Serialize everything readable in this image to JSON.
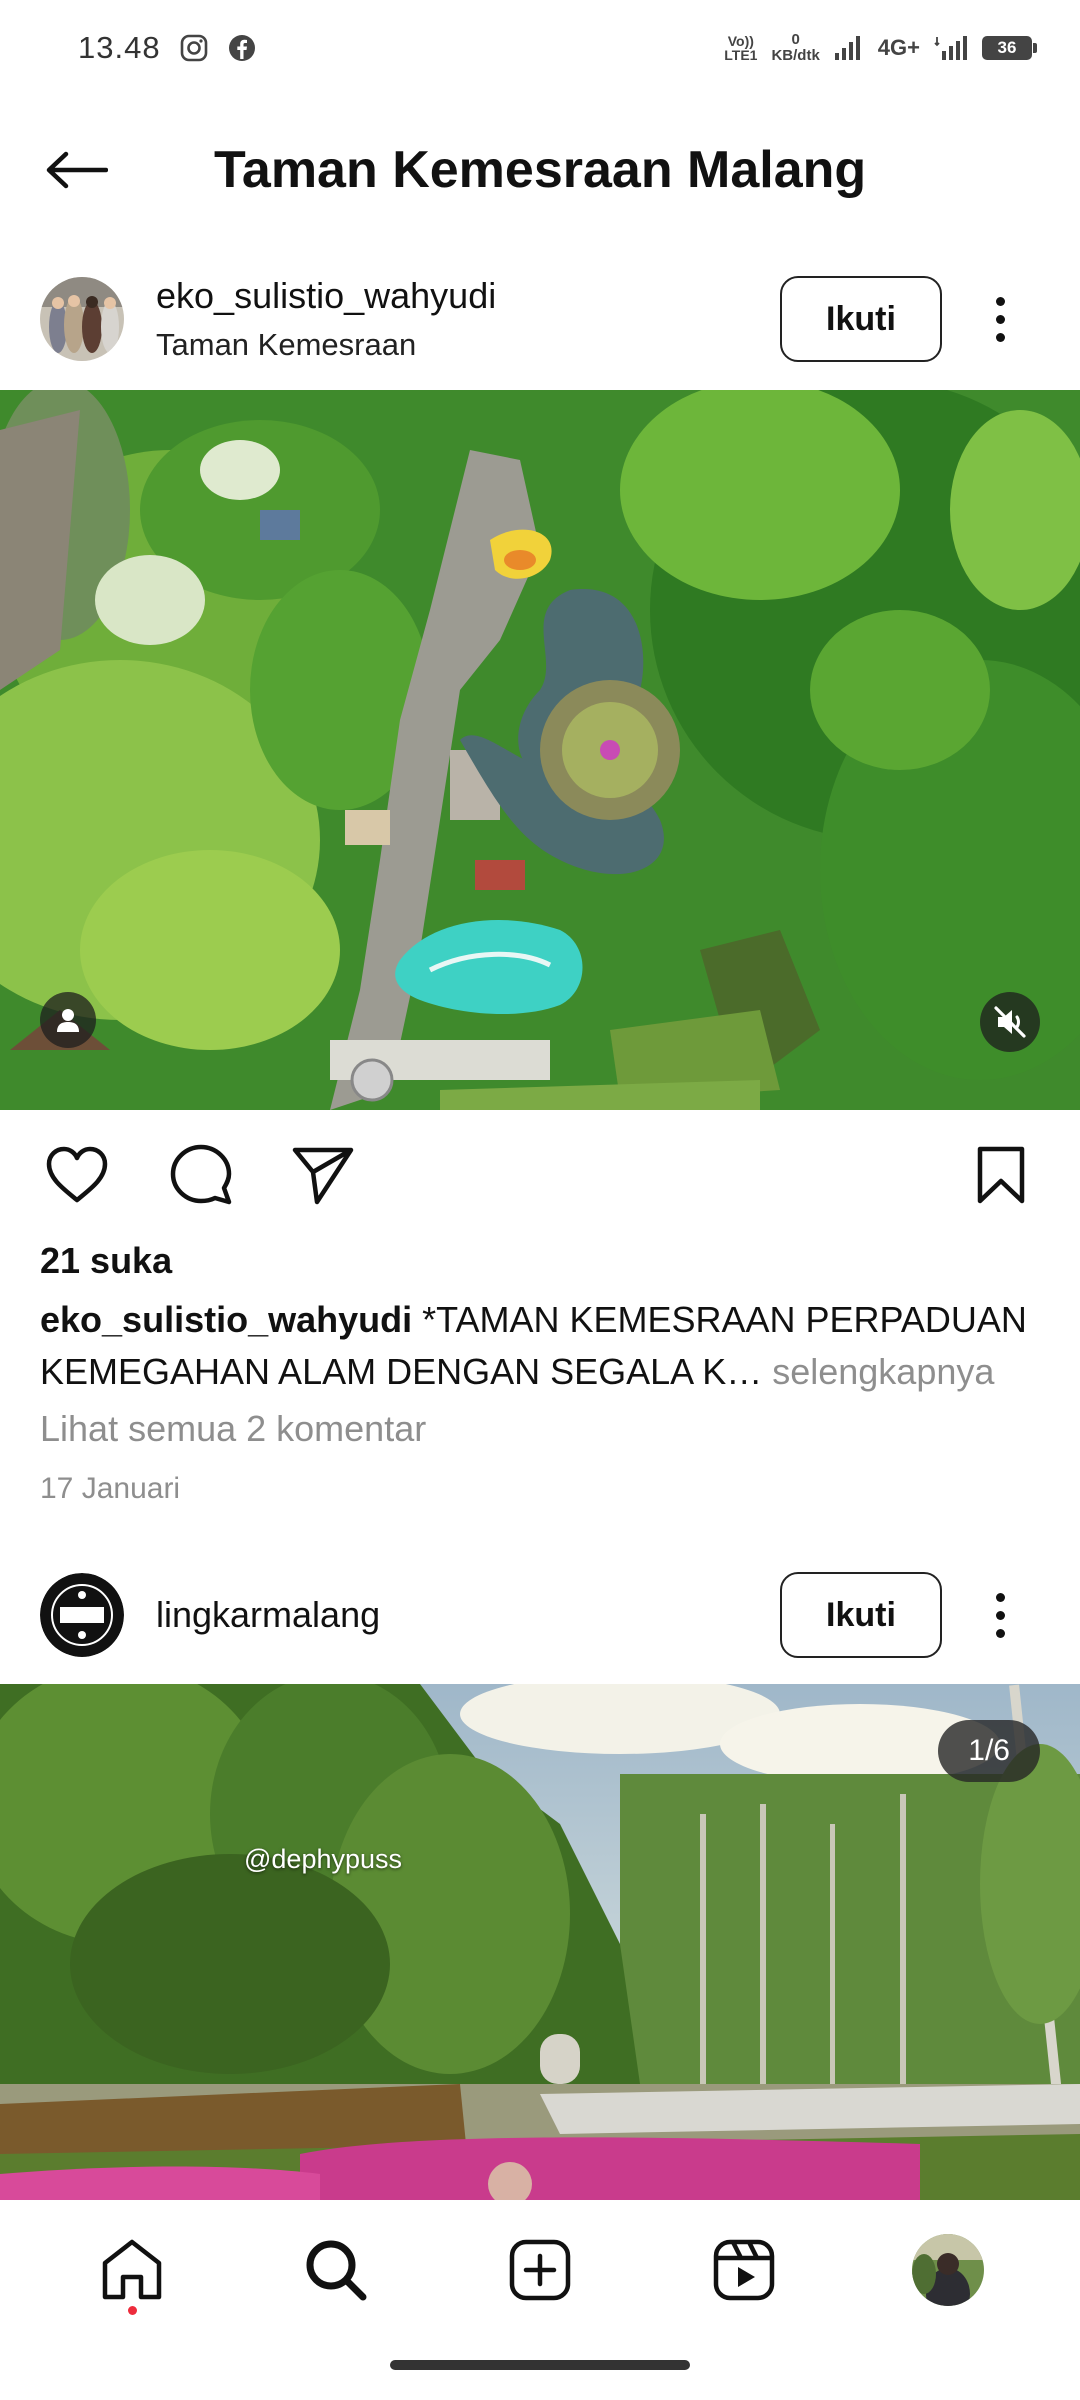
{
  "status_bar": {
    "time": "13.48",
    "notif_icons": [
      "instagram-icon",
      "facebook-icon"
    ],
    "volte_line1": "Vo))",
    "volte_line2": "LTE1",
    "speed_value": "0",
    "speed_unit": "KB/dtk",
    "network_type": "4G+",
    "battery_level": "36"
  },
  "header": {
    "title": "Taman Kemesraan Malang"
  },
  "post1": {
    "username": "eko_sulistio_wahyudi",
    "location": "Taman Kemesraan",
    "follow_label": "Ikuti",
    "likes": "21 suka",
    "caption_user": "eko_sulistio_wahyudi",
    "caption_text": " *TAMAN KEMESRAAN PERPADUAN KEMEGAHAN ALAM DENGAN SEGALA K…",
    "caption_more": " selengkapnya",
    "view_comments": "Lihat semua 2 komentar",
    "date": "17 Januari"
  },
  "post2": {
    "username": "lingkarmalang",
    "follow_label": "Ikuti",
    "counter": "1/6",
    "watermark": "@dephypuss"
  },
  "colors": {
    "accent_dot": "#ed2c3c",
    "muted_text": "#8e8e8e"
  },
  "nav": [
    "home-icon",
    "search-icon",
    "create-icon",
    "reels-icon",
    "profile-avatar"
  ]
}
